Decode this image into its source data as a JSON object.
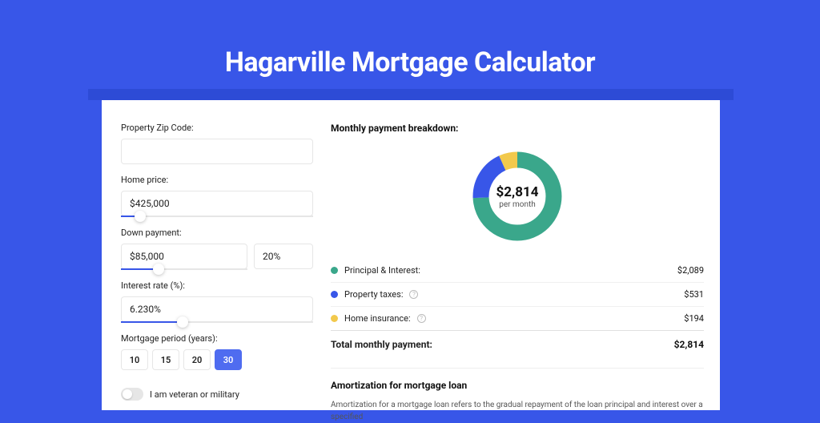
{
  "title": "Hagarville Mortgage Calculator",
  "form": {
    "zip": {
      "label": "Property Zip Code:",
      "value": ""
    },
    "home_price": {
      "label": "Home price:",
      "value": "$425,000",
      "slider_pct": 10
    },
    "down_payment": {
      "label": "Down payment:",
      "value": "$85,000",
      "pct_value": "20%",
      "slider_pct": 30
    },
    "interest_rate": {
      "label": "Interest rate (%):",
      "value": "6.230%",
      "slider_pct": 32
    },
    "mortgage_period": {
      "label": "Mortgage period (years):",
      "options": [
        "10",
        "15",
        "20",
        "30"
      ],
      "selected": "30"
    },
    "veteran": {
      "label": "I am veteran or military",
      "on": false
    }
  },
  "breakdown": {
    "title": "Monthly payment breakdown:",
    "center_amount": "$2,814",
    "center_sub": "per month",
    "items": [
      {
        "label": "Principal & Interest:",
        "value": "$2,089",
        "color": "#3aa78b",
        "info": false
      },
      {
        "label": "Property taxes:",
        "value": "$531",
        "color": "#3856e8",
        "info": true
      },
      {
        "label": "Home insurance:",
        "value": "$194",
        "color": "#f2c94c",
        "info": true
      }
    ],
    "total": {
      "label": "Total monthly payment:",
      "value": "$2,814"
    }
  },
  "amortization": {
    "title": "Amortization for mortgage loan",
    "text": "Amortization for a mortgage loan refers to the gradual repayment of the loan principal and interest over a specified"
  },
  "chart_data": {
    "type": "pie",
    "title": "Monthly payment breakdown",
    "series": [
      {
        "name": "Principal & Interest",
        "value": 2089,
        "color": "#3aa78b"
      },
      {
        "name": "Property taxes",
        "value": 531,
        "color": "#3856e8"
      },
      {
        "name": "Home insurance",
        "value": 194,
        "color": "#f2c94c"
      }
    ],
    "total": 2814,
    "center_label": "$2,814 per month"
  }
}
